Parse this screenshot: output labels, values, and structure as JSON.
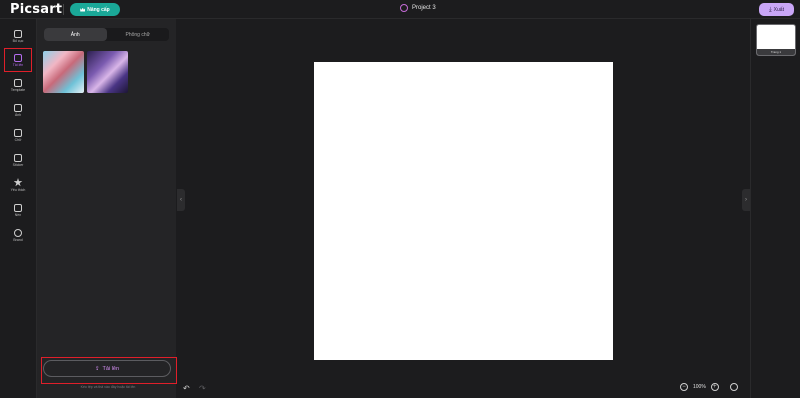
{
  "header": {
    "logo": "Picsart",
    "upgrade_label": "Nâng cấp",
    "project_title": "Project 3",
    "export_label": "Xuất"
  },
  "rail": {
    "items": [
      {
        "label": "Bố cục",
        "icon": "layout-icon"
      },
      {
        "label": "Tải lên",
        "icon": "upload-icon"
      },
      {
        "label": "Template",
        "icon": "template-icon"
      },
      {
        "label": "Ảnh",
        "icon": "image-icon"
      },
      {
        "label": "Chữ",
        "icon": "text-icon"
      },
      {
        "label": "Sticker",
        "icon": "sticker-icon"
      },
      {
        "label": "Yêu thích",
        "icon": "star-icon"
      },
      {
        "label": "Nền",
        "icon": "background-icon"
      },
      {
        "label": "Brand",
        "icon": "brand-icon"
      }
    ]
  },
  "panel": {
    "tabs": [
      "Ảnh",
      "Phông chữ"
    ],
    "upload_label": "Tải lên",
    "hint": "Kéo tệp và thả vào đây hoặc tải lên"
  },
  "pages": {
    "thumb_label": "Trang 1"
  },
  "zoom": {
    "value": "100%"
  },
  "colors": {
    "accent": "#c9a6f7",
    "upgrade": "#1aa898",
    "highlight": "#e01f2a"
  }
}
